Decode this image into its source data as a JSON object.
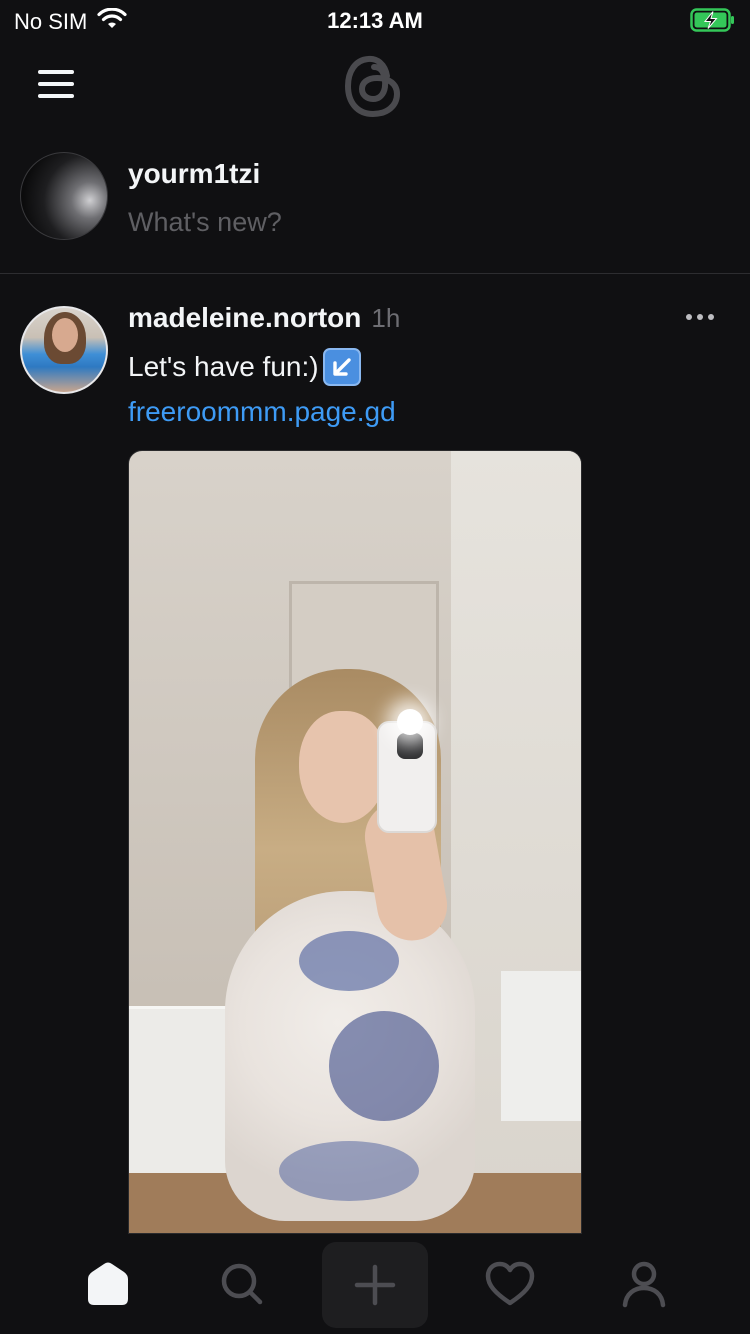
{
  "status_bar": {
    "carrier": "No SIM",
    "time": "12:13 AM",
    "battery_state": "charging",
    "battery_color": "#34c759"
  },
  "nav": {
    "logo": "threads-logo-icon",
    "menu_icon": "hamburger-menu-icon"
  },
  "composer": {
    "username": "yourm1tzi",
    "placeholder": "What's new?"
  },
  "post": {
    "username": "madeleine.norton",
    "time": "1h",
    "text": "Let's have fun:)",
    "emoji": "arrow-down-left-emoji",
    "link": "freeroommm.page.gd",
    "link_color": "#3e9bf5",
    "image_description_icon": "post-photo"
  },
  "tab_bar": {
    "items": [
      {
        "name": "home",
        "icon": "home-icon",
        "active": true
      },
      {
        "name": "search",
        "icon": "search-icon",
        "active": false
      },
      {
        "name": "create",
        "icon": "plus-icon",
        "active": false
      },
      {
        "name": "activity",
        "icon": "heart-icon",
        "active": false
      },
      {
        "name": "profile",
        "icon": "person-icon",
        "active": false
      }
    ]
  },
  "colors": {
    "background": "#101012",
    "text": "#f3f5f7",
    "muted": "#6e6e73"
  }
}
